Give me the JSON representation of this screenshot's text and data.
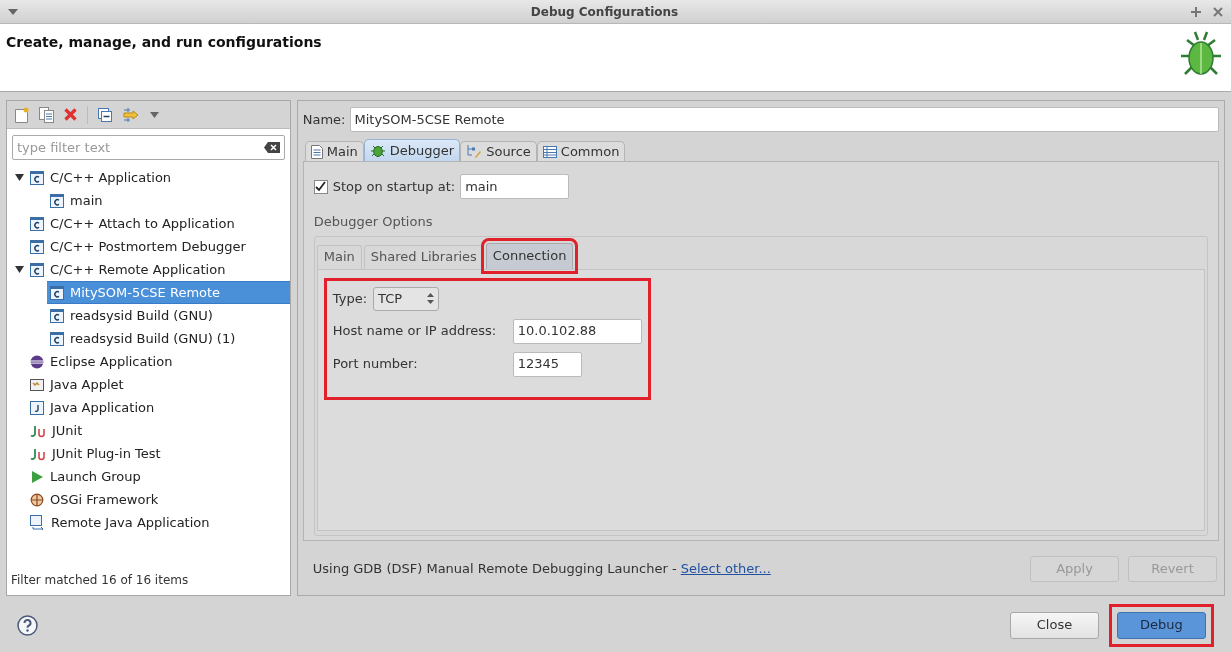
{
  "window": {
    "title": "Debug Configurations"
  },
  "header": {
    "title": "Create, manage, and run configurations"
  },
  "filter": {
    "placeholder": "type filter text"
  },
  "tree": [
    {
      "label": "C/C++ Application",
      "kind": "c",
      "expanded": true,
      "selected": false,
      "children": [
        {
          "label": "main",
          "kind": "c",
          "selected": false
        }
      ]
    },
    {
      "label": "C/C++ Attach to Application",
      "kind": "c",
      "selected": false
    },
    {
      "label": "C/C++ Postmortem Debugger",
      "kind": "c",
      "selected": false
    },
    {
      "label": "C/C++ Remote Application",
      "kind": "c",
      "expanded": true,
      "selected": false,
      "children": [
        {
          "label": "MitySOM-5CSE Remote",
          "kind": "c",
          "selected": true
        },
        {
          "label": "readsysid Build (GNU)",
          "kind": "c",
          "selected": false
        },
        {
          "label": "readsysid Build (GNU) (1)",
          "kind": "c",
          "selected": false
        }
      ]
    },
    {
      "label": "Eclipse Application",
      "kind": "eclipse",
      "selected": false
    },
    {
      "label": "Java Applet",
      "kind": "applet",
      "selected": false
    },
    {
      "label": "Java Application",
      "kind": "java",
      "selected": false
    },
    {
      "label": "JUnit",
      "kind": "junit",
      "selected": false
    },
    {
      "label": "JUnit Plug-in Test",
      "kind": "junit",
      "selected": false
    },
    {
      "label": "Launch Group",
      "kind": "launch",
      "selected": false
    },
    {
      "label": "OSGi Framework",
      "kind": "osgi",
      "selected": false
    },
    {
      "label": "Remote Java Application",
      "kind": "remote",
      "selected": false
    }
  ],
  "filter_status": "Filter matched 16 of 16 items",
  "name": {
    "label": "Name:",
    "value": "MitySOM-5CSE Remote"
  },
  "tabs": [
    {
      "label": "Main",
      "kind": "page",
      "selected": false
    },
    {
      "label": "Debugger",
      "kind": "bug",
      "selected": true
    },
    {
      "label": "Source",
      "kind": "source",
      "selected": false
    },
    {
      "label": "Common",
      "kind": "table",
      "selected": false
    }
  ],
  "stop_on_startup": {
    "label": "Stop on startup at:",
    "checked": true,
    "value": "main"
  },
  "debugger_options": {
    "title": "Debugger Options",
    "tabs": [
      {
        "label": "Main",
        "selected": false,
        "highlighted": false
      },
      {
        "label": "Shared Libraries",
        "selected": false,
        "highlighted": false
      },
      {
        "label": "Connection",
        "selected": true,
        "highlighted": true
      }
    ],
    "highlighted": true,
    "fields": [
      {
        "kind": "select",
        "label": "Type:",
        "value": "TCP"
      },
      {
        "kind": "text",
        "label": "Host name or IP address:",
        "value": "10.0.102.88"
      },
      {
        "kind": "text",
        "label": "Port number:",
        "value": "12345"
      }
    ]
  },
  "launcher": {
    "text": "Using GDB (DSF) Manual Remote Debugging Launcher - ",
    "link": "Select other..."
  },
  "panel_buttons": [
    {
      "label": "Apply",
      "disabled": true
    },
    {
      "label": "Revert",
      "disabled": true
    }
  ],
  "footer_buttons": [
    {
      "label": "Close",
      "default": false,
      "highlighted": false
    },
    {
      "label": "Debug",
      "default": true,
      "highlighted": true
    }
  ]
}
